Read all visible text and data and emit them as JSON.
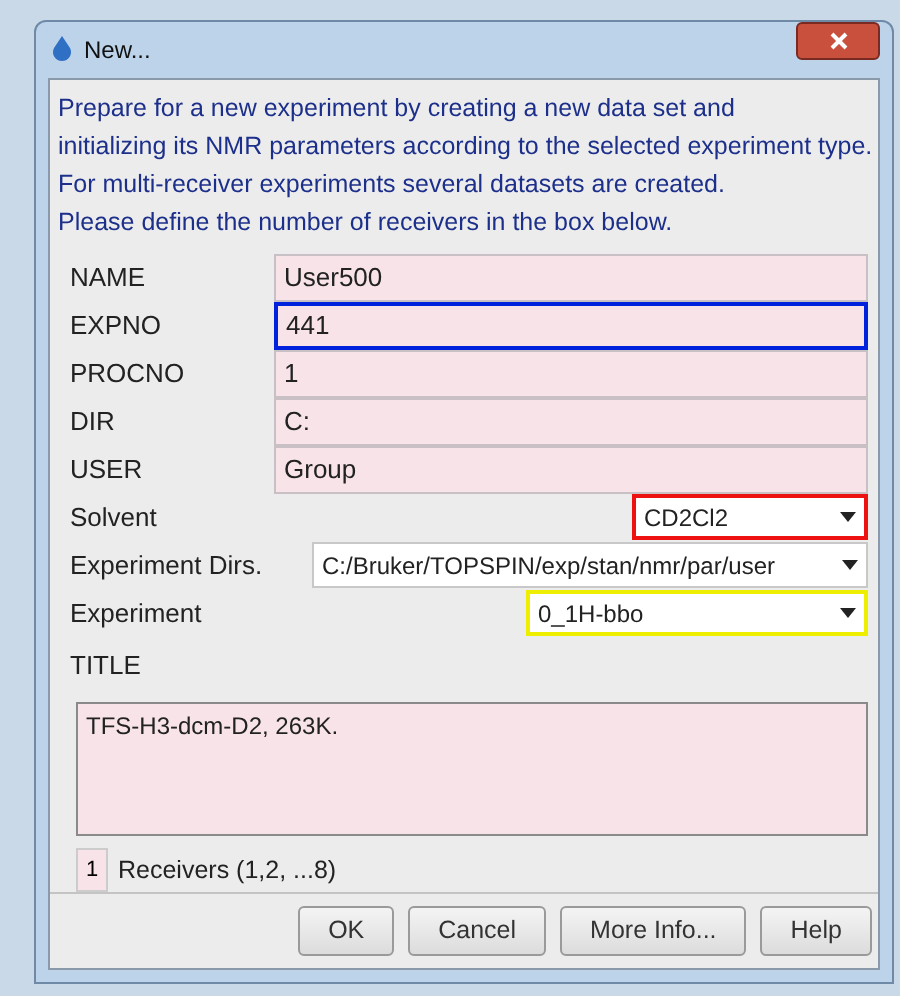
{
  "window": {
    "title": "New..."
  },
  "intro": [
    "Prepare for a new experiment by creating a new data set and",
    "initializing its NMR parameters according to the selected experiment type.",
    "For multi-receiver experiments several datasets are created.",
    "Please define the number of receivers in the box below."
  ],
  "fields": [
    {
      "kind": "text",
      "label": "NAME",
      "value": "User500"
    },
    {
      "kind": "text",
      "label": "EXPNO",
      "value": "441",
      "color": "#0022dd"
    },
    {
      "kind": "text",
      "label": "PROCNO",
      "value": "1"
    },
    {
      "kind": "text",
      "label": "DIR",
      "value": "C:"
    },
    {
      "kind": "text",
      "label": "USER",
      "value": "Group"
    },
    {
      "kind": "select",
      "label": "Solvent",
      "value": "CD2Cl2",
      "color": "#ee1111"
    },
    {
      "kind": "select",
      "label": "Experiment Dirs.",
      "value": "C:/Bruker/TOPSPIN/exp/stan/nmr/par/user"
    },
    {
      "kind": "select",
      "label": "Experiment",
      "value": "0_1H-bbo",
      "color": "#eeee00"
    }
  ],
  "title_field": {
    "label": "TITLE",
    "value": "TFS-H3-dcm-D2, 263K."
  },
  "receivers": {
    "value": "1",
    "label": "Receivers (1,2, ...8)"
  },
  "buttons": [
    "OK",
    "Cancel",
    "More Info...",
    "Help"
  ]
}
